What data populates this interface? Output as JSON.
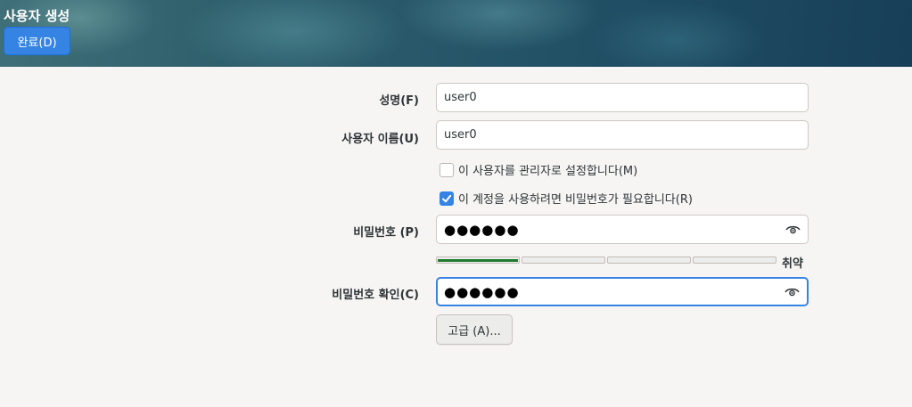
{
  "header": {
    "title": "사용자 생성",
    "done_label": "완료(D)"
  },
  "form": {
    "fullname": {
      "label": "성명(F)",
      "value": "user0"
    },
    "username": {
      "label": "사용자 이름(U)",
      "value": "user0"
    },
    "admin_checkbox": {
      "label": "이 사용자를 관리자로 설정합니다(M)",
      "checked": false
    },
    "require_password_checkbox": {
      "label": "이 계정을 사용하려면 비밀번호가 필요합니다(R)",
      "checked": true
    },
    "password": {
      "label": "비밀번호 (P)",
      "masked": "●●●●●●"
    },
    "strength": {
      "text": "취약",
      "level": 0.25
    },
    "confirm": {
      "label": "비밀번호 확인(C)",
      "masked": "●●●●●●"
    },
    "advanced_label": "고급 (A)..."
  },
  "colors": {
    "accent": "#3584e4",
    "strength_fill": "#1e7a2e"
  }
}
